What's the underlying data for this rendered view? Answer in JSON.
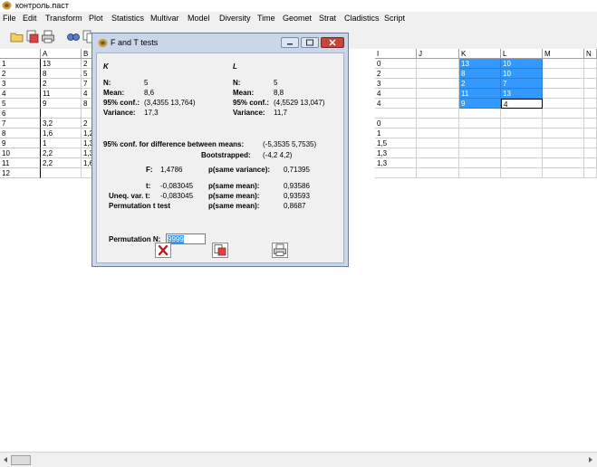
{
  "window": {
    "title": "контроль.паст"
  },
  "menu": [
    "File",
    "Edit",
    "Transform",
    "Plot",
    "Statistics",
    "Multivar",
    "Model",
    "Diversity",
    "Time",
    "Geomet",
    "Strat",
    "Cladistics",
    "Script"
  ],
  "toolbar": {
    "icons": [
      "open-folder-icon",
      "save-icon",
      "print-icon",
      "find-icon",
      "copy-icon"
    ]
  },
  "sheet": {
    "columns": [
      "",
      "A",
      "B",
      "I",
      "J",
      "K",
      "L",
      "M",
      "N"
    ],
    "rows": [
      "1",
      "2",
      "3",
      "4",
      "5",
      "6",
      "7",
      "8",
      "9",
      "10",
      "11",
      "12"
    ],
    "colA": [
      "13",
      "8",
      "2",
      "11",
      "9",
      "",
      "3,2",
      "1,6",
      "1",
      "2,2",
      "2,2",
      ""
    ],
    "colB": [
      "2",
      "5",
      "7",
      "4",
      "8",
      "",
      "2",
      "1,2",
      "1,3",
      "1,3",
      "1,6",
      ""
    ],
    "colI": [
      "0",
      "2",
      "3",
      "4",
      "4",
      "",
      "0",
      "1",
      "1,5",
      "1,3",
      "1,3",
      ""
    ],
    "colK": [
      "13",
      "8",
      "2",
      "11",
      "9",
      "",
      "",
      "",
      "",
      "",
      "",
      ""
    ],
    "colL": [
      "10",
      "10",
      "7",
      "13",
      "4",
      "",
      "",
      "",
      "",
      "",
      "",
      ""
    ]
  },
  "dialog": {
    "title": "F and T tests",
    "group1": {
      "name": "K",
      "n_label": "N:",
      "n": "5",
      "mean_label": "Mean:",
      "mean": "8,6",
      "conf_label": "95% conf.:",
      "conf": "(3,4355 13,764)",
      "var_label": "Variance:",
      "var": "17,3"
    },
    "group2": {
      "name": "L",
      "n_label": "N:",
      "n": "5",
      "mean_label": "Mean:",
      "mean": "8,8",
      "conf_label": "95% conf.:",
      "conf": "(4,5529 13,047)",
      "var_label": "Variance:",
      "var": "11,7"
    },
    "diff": {
      "label": "95% conf.  for difference between means:",
      "value": "(-5,3535 5,7535)",
      "boot_label": "Bootstrapped:",
      "boot_value": "(-4,2 4,2)"
    },
    "tests": {
      "f_label": "F:",
      "f": "1,4786",
      "pvar_label": "p(same variance):",
      "pvar": "0,71395",
      "t_label": "t:",
      "t": "-0,083045",
      "pmean1_label": "p(same mean):",
      "pmean1": "0,93586",
      "uneq_label": "Uneq. var. t:",
      "uneq": "-0,083045",
      "pmean2_label": "p(same mean):",
      "pmean2": "0,93593",
      "perm_label": "Permutation t test",
      "pmean3_label": "p(same mean):",
      "pmean3": "0,8687"
    },
    "perm_n_label": "Permutation N:",
    "perm_n": "9999",
    "buttons": [
      "close-icon",
      "copy-icon",
      "print-icon"
    ]
  }
}
